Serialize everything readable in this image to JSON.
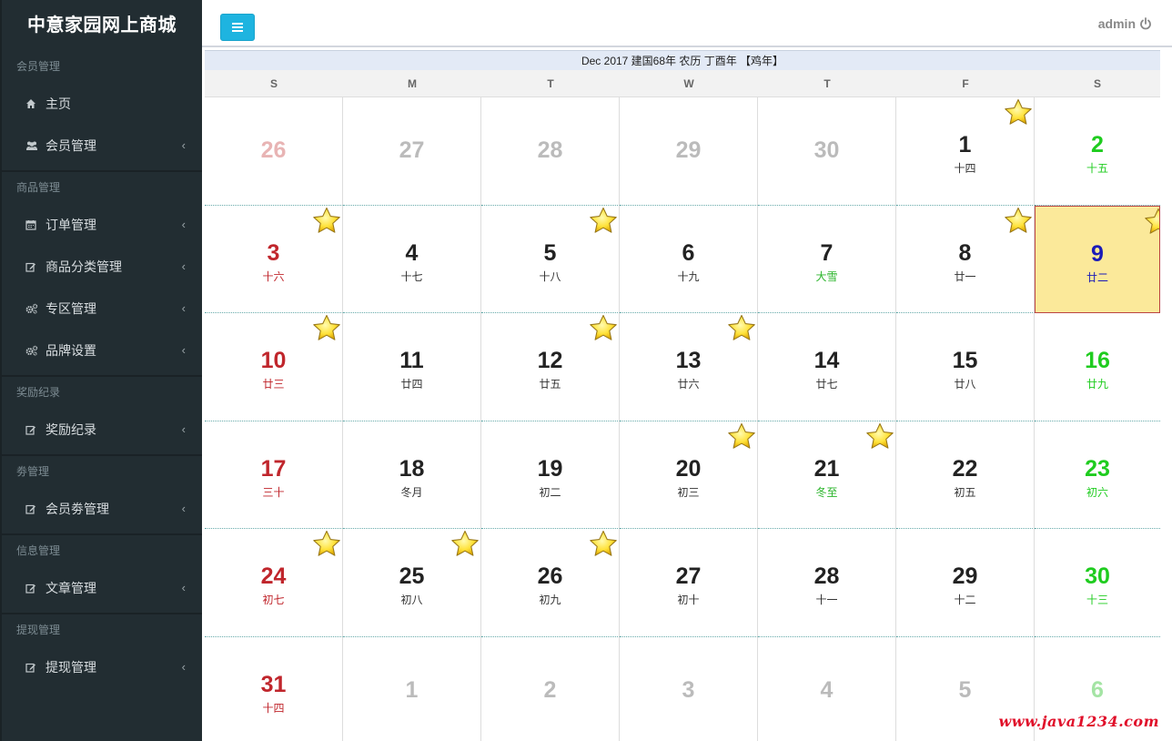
{
  "brand": "中意家园网上商城",
  "sidebar": {
    "sections": [
      {
        "header": "会员管理",
        "items": [
          {
            "label": "主页",
            "icon": "home-icon",
            "chevron": false
          },
          {
            "label": "会员管理",
            "icon": "users-icon",
            "chevron": true
          }
        ]
      },
      {
        "header": "商品管理",
        "items": [
          {
            "label": "订单管理",
            "icon": "calendar-icon",
            "chevron": true
          },
          {
            "label": "商品分类管理",
            "icon": "edit-icon",
            "chevron": true
          },
          {
            "label": "专区管理",
            "icon": "cogs-icon",
            "chevron": true
          },
          {
            "label": "品牌设置",
            "icon": "cogs-icon",
            "chevron": true
          }
        ]
      },
      {
        "header": "奖励纪录",
        "items": [
          {
            "label": "奖励纪录",
            "icon": "edit-icon",
            "chevron": true
          }
        ]
      },
      {
        "header": "劵管理",
        "items": [
          {
            "label": "会员劵管理",
            "icon": "edit-icon",
            "chevron": true
          }
        ]
      },
      {
        "header": "信息管理",
        "items": [
          {
            "label": "文章管理",
            "icon": "edit-icon",
            "chevron": true
          }
        ]
      },
      {
        "header": "提现管理",
        "items": [
          {
            "label": "提现管理",
            "icon": "edit-icon",
            "chevron": true
          }
        ]
      }
    ],
    "chevron_glyph": "‹"
  },
  "topbar": {
    "user": "admin",
    "menu_icon": "hamburger-icon",
    "power_icon": "power-icon"
  },
  "calendar": {
    "title": "Dec 2017 建国68年 农历 丁酉年 【鸡年】",
    "weekdays": [
      "S",
      "M",
      "T",
      "W",
      "T",
      "F",
      "S"
    ],
    "weeks": [
      [
        {
          "d": "26",
          "l": "",
          "o": true
        },
        {
          "d": "27",
          "l": "",
          "o": true
        },
        {
          "d": "28",
          "l": "",
          "o": true
        },
        {
          "d": "29",
          "l": "",
          "o": true
        },
        {
          "d": "30",
          "l": "",
          "o": true
        },
        {
          "d": "1",
          "l": "十四",
          "s": true
        },
        {
          "d": "2",
          "l": "十五"
        }
      ],
      [
        {
          "d": "3",
          "l": "十六",
          "s": true
        },
        {
          "d": "4",
          "l": "十七"
        },
        {
          "d": "5",
          "l": "十八",
          "s": true
        },
        {
          "d": "6",
          "l": "十九"
        },
        {
          "d": "7",
          "l": "大雪",
          "t": true
        },
        {
          "d": "8",
          "l": "廿一",
          "s": true
        },
        {
          "d": "9",
          "l": "廿二",
          "s": true,
          "today": true
        }
      ],
      [
        {
          "d": "10",
          "l": "廿三",
          "s": true
        },
        {
          "d": "11",
          "l": "廿四"
        },
        {
          "d": "12",
          "l": "廿五",
          "s": true
        },
        {
          "d": "13",
          "l": "廿六",
          "s": true
        },
        {
          "d": "14",
          "l": "廿七"
        },
        {
          "d": "15",
          "l": "廿八"
        },
        {
          "d": "16",
          "l": "廿九"
        }
      ],
      [
        {
          "d": "17",
          "l": "三十"
        },
        {
          "d": "18",
          "l": "冬月"
        },
        {
          "d": "19",
          "l": "初二"
        },
        {
          "d": "20",
          "l": "初三",
          "s": true
        },
        {
          "d": "21",
          "l": "冬至",
          "s": true,
          "t": true
        },
        {
          "d": "22",
          "l": "初五"
        },
        {
          "d": "23",
          "l": "初六"
        }
      ],
      [
        {
          "d": "24",
          "l": "初七",
          "s": true
        },
        {
          "d": "25",
          "l": "初八",
          "s": true
        },
        {
          "d": "26",
          "l": "初九",
          "s": true
        },
        {
          "d": "27",
          "l": "初十"
        },
        {
          "d": "28",
          "l": "十一"
        },
        {
          "d": "29",
          "l": "十二"
        },
        {
          "d": "30",
          "l": "十三"
        }
      ],
      [
        {
          "d": "31",
          "l": "十四"
        },
        {
          "d": "1",
          "l": "",
          "o": true
        },
        {
          "d": "2",
          "l": "",
          "o": true
        },
        {
          "d": "3",
          "l": "",
          "o": true
        },
        {
          "d": "4",
          "l": "",
          "o": true
        },
        {
          "d": "5",
          "l": "",
          "o": true
        },
        {
          "d": "6",
          "l": "",
          "o": true
        }
      ]
    ]
  },
  "watermark": "www.java1234.com"
}
